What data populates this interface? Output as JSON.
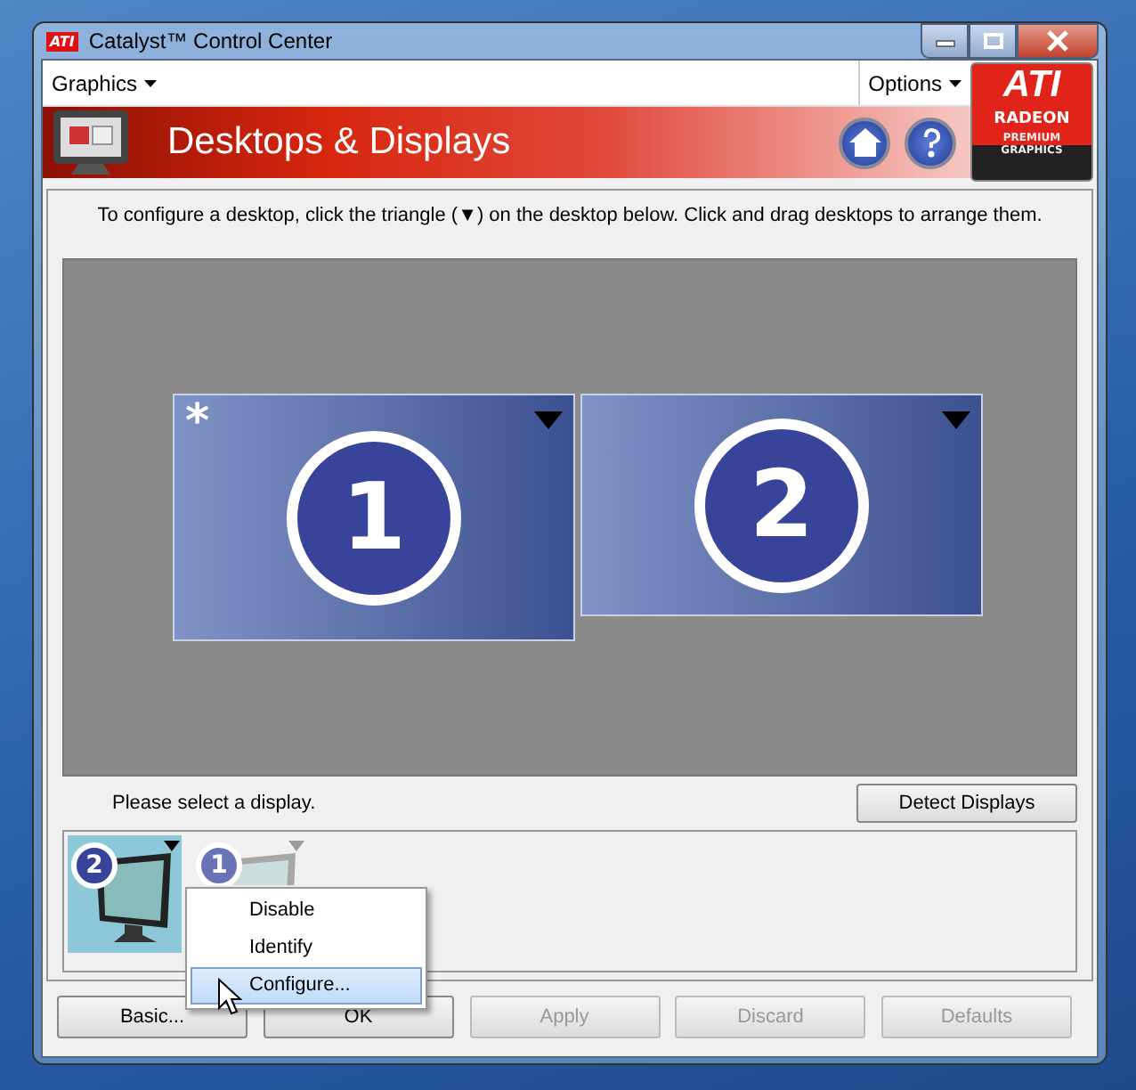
{
  "window": {
    "title": "Catalyst™ Control Center",
    "logo": "ATI"
  },
  "menu": {
    "left": "Graphics",
    "right": "Options"
  },
  "brand": {
    "name": "ATI",
    "product": "RADEON",
    "tagline1": "PREMIUM",
    "tagline2": "GRAPHICS"
  },
  "header": {
    "title": "Desktops & Displays"
  },
  "instructions": "To configure a desktop, click the triangle (▼) on the desktop below.  Click and drag desktops to arrange them.",
  "desktops": [
    {
      "number": "1",
      "badge": "*"
    },
    {
      "number": "2"
    }
  ],
  "display_prompt": "Please select a display.",
  "detect_button": "Detect Displays",
  "displays": [
    {
      "number": "2",
      "selected": true
    },
    {
      "number": "1",
      "selected": false
    }
  ],
  "context_menu": [
    {
      "label": "Disable",
      "selected": false
    },
    {
      "label": "Identify",
      "selected": false
    },
    {
      "label": "Configure...",
      "selected": true
    }
  ],
  "buttons": [
    {
      "label": "Basic...",
      "disabled": false
    },
    {
      "label": "OK",
      "disabled": false
    },
    {
      "label": "Apply",
      "disabled": true
    },
    {
      "label": "Discard",
      "disabled": true
    },
    {
      "label": "Defaults",
      "disabled": true
    }
  ]
}
